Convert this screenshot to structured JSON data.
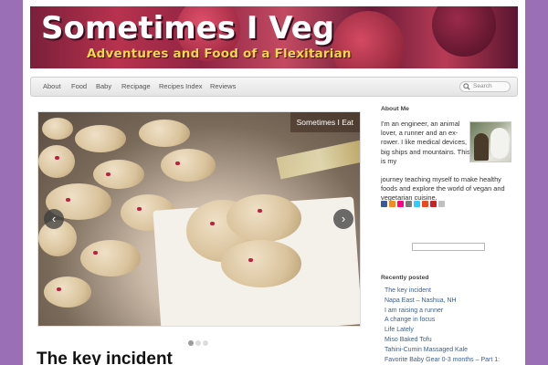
{
  "header": {
    "title": "Sometimes I Veg",
    "subtitle": "Adventures and Food of a Flexitarian"
  },
  "nav": {
    "items": [
      "About",
      "Food",
      "Baby",
      "Recipage",
      "Recipes Index",
      "Reviews"
    ],
    "search_placeholder": "Search"
  },
  "slider": {
    "caption": "Sometimes I Eat",
    "prev_label": "‹",
    "next_label": "›",
    "pages": 3,
    "active_page": 1
  },
  "post": {
    "title": "The key incident"
  },
  "sidebar": {
    "about_heading": "About Me",
    "about_text_1": "I'm an engineer, an animal lover, a runner and an ex-rower. I like medical devices, big ships and mountains. This is my",
    "about_text_2": "journey teaching myself to make healthy foods and explore the world of vegan and vegetarian cuisine.",
    "social_icons": [
      "facebook-icon",
      "rss-icon",
      "flickr-icon",
      "email-icon",
      "twitter-icon",
      "stumbleupon-icon",
      "pinterest-icon",
      "mail-icon"
    ],
    "recent_heading": "Recently posted",
    "recent_posts": [
      "The key incident",
      "Napa East – Nashua, NH",
      "I am raising a runner",
      "A change in focus",
      "Life Lately",
      "Miso Baked Tofu",
      "Tahini-Cumin Massaged Kale",
      "Favorite Baby Gear 0-3 months – Part 1:"
    ]
  },
  "colors": {
    "background": "#9a6fb5",
    "link": "#3a5f8f",
    "banner_text": "#ffffff",
    "banner_subtitle": "#f6d64a"
  }
}
